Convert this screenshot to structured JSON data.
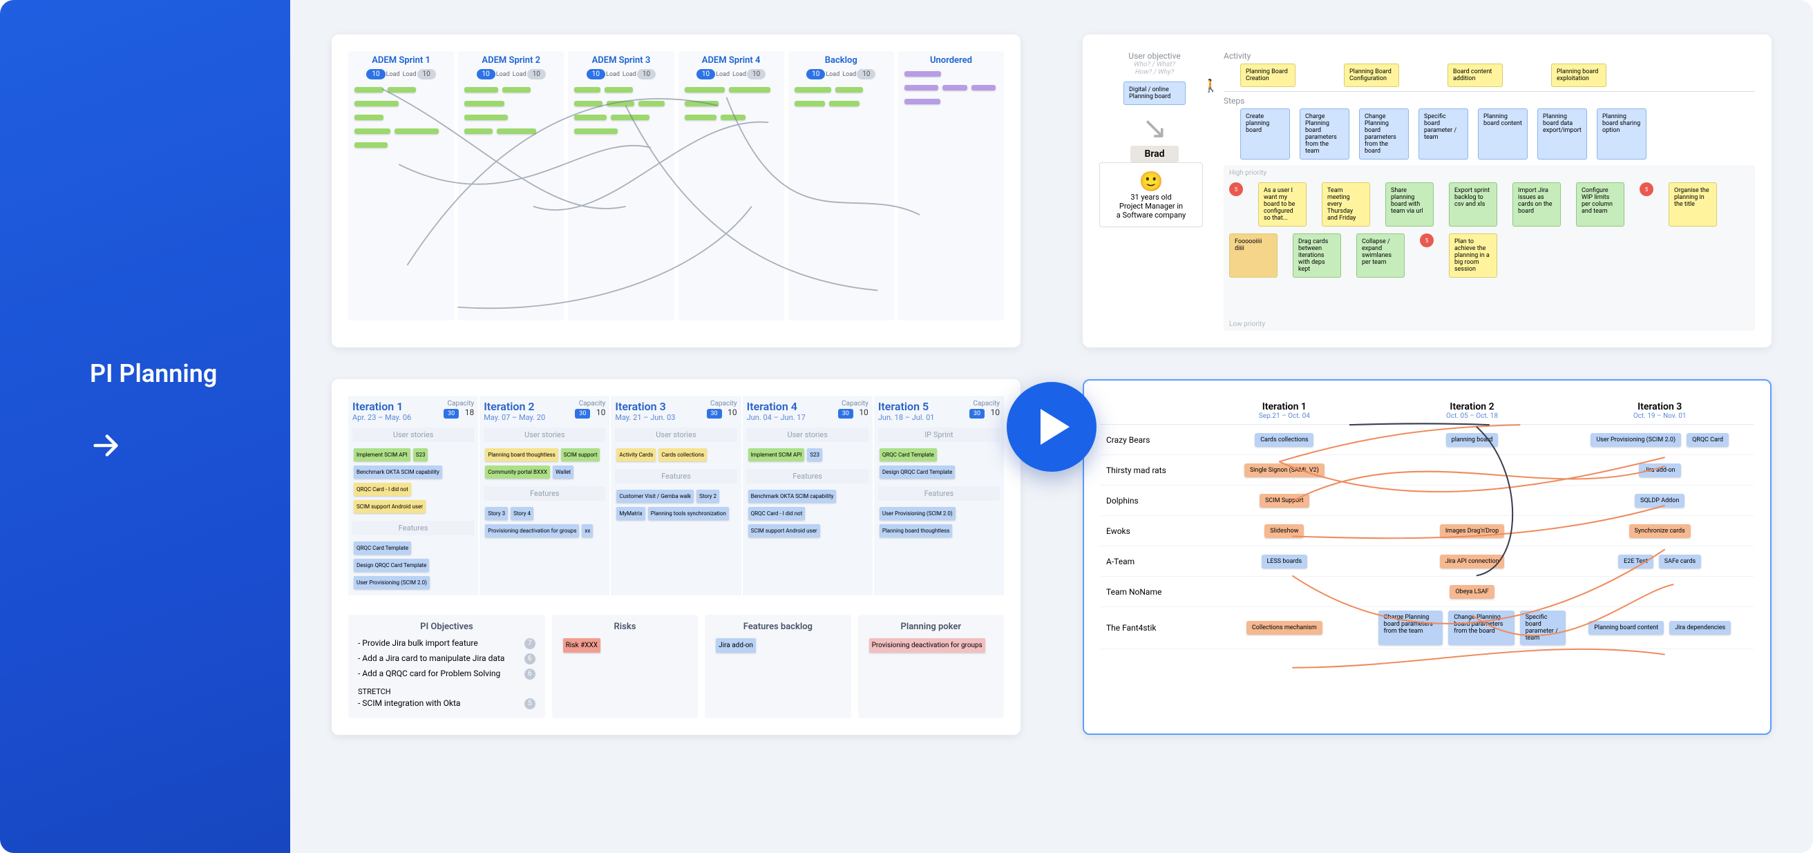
{
  "sidebar": {
    "title": "PI Planning"
  },
  "panel_tl": {
    "columns": [
      {
        "name": "ADEM Sprint 1",
        "load": "Load",
        "load2": "Load",
        "cards": 7
      },
      {
        "name": "ADEM Sprint 2",
        "load": "Load",
        "load2": "Load",
        "cards": 6
      },
      {
        "name": "ADEM Sprint 3",
        "load": "Load",
        "load2": "Load",
        "cards": 8
      },
      {
        "name": "ADEM Sprint 4",
        "load": "Load",
        "load2": "Load",
        "cards": 5
      },
      {
        "name": "Backlog",
        "load": "Load",
        "load2": "Load",
        "cards": 4
      },
      {
        "name": "Unordered",
        "load": "",
        "load2": "",
        "cards": 5
      }
    ]
  },
  "panel_tr": {
    "label_user_objective": "User objective",
    "label_sub1": "Who? / What?",
    "label_sub2": "How? / Why?",
    "label_activity": "Activity",
    "label_steps": "Steps",
    "label_high": "High priority",
    "label_low": "Low priority",
    "persona_name": "Brad",
    "persona_line1": "31 years old",
    "persona_line2": "Project Manager in",
    "persona_line3": "a Software company",
    "root_card": "Digital / online Planning board",
    "activities": [
      "Planning Board Creation",
      "Planning Board Configuration",
      "Board content addition",
      "Planning board exploitation"
    ],
    "steps": [
      "Create planning board",
      "Charge Planning board parameters from the team",
      "Change Planning board parameters from the board",
      "Specific board parameter / team",
      "Planning board content",
      "Planning board data export/import",
      "Planning board sharing option"
    ]
  },
  "panel_bl": {
    "iterations": [
      {
        "title": "Iteration 1",
        "dates": "Apr. 23 – May. 06",
        "cap": "30",
        "count": "18",
        "band": "User stories"
      },
      {
        "title": "Iteration 2",
        "dates": "May. 07 – May. 20",
        "cap": "30",
        "count": "10",
        "band": "User stories"
      },
      {
        "title": "Iteration 3",
        "dates": "May. 21 – Jun. 03",
        "cap": "30",
        "count": "10",
        "band": "User stories"
      },
      {
        "title": "Iteration 4",
        "dates": "Jun. 04 – Jun. 17",
        "cap": "30",
        "count": "10",
        "band": "User stories"
      },
      {
        "title": "Iteration 5",
        "dates": "Jun. 18 – Jul. 01",
        "cap": "30",
        "count": "10",
        "band": "IP Sprint"
      }
    ],
    "capacity_label": "Capacity",
    "features_band": "Features",
    "objectives_title": "PI Objectives",
    "objectives": [
      {
        "text": "- Provide Jira bulk import feature",
        "badge": "7"
      },
      {
        "text": "- Add a Jira card to manipulate Jira data",
        "badge": "6"
      },
      {
        "text": "- Add a QRQC card for Problem Solving",
        "badge": "6"
      }
    ],
    "stretch_label": "STRETCH",
    "stretch_item": "- SCIM integration with Okta",
    "stretch_badge": "5",
    "risks_title": "Risks",
    "risks_card": "Risk #XXX",
    "backlog_title": "Features backlog",
    "backlog_card": "Jira add-on",
    "poker_title": "Planning poker",
    "poker_card": "Provisioning deactivation for groups",
    "story_cards": [
      "Implement SCIM API",
      "S23",
      "Benchmark OKTA SCIM capability",
      "QRQC Card - I did not",
      "SCIM support Android user",
      "QRQC Card Template",
      "Design QRQC Card Template",
      "User Provisioning (SCIM 2.0)",
      "Planning board thoughtless",
      "SCIM support",
      "Community portal BXXX",
      "Wallet",
      "Story 3",
      "Story 4",
      "Provisioning deactivation for groups",
      "xx",
      "Activity Cards",
      "Cards collections",
      "Customer Visit / Gemba walk",
      "Story 2",
      "MyMatrix",
      "Planning tools synchronization"
    ]
  },
  "panel_br": {
    "iterations": [
      {
        "title": "Iteration 1",
        "dates": "Sep.21 – Oct. 04"
      },
      {
        "title": "Iteration 2",
        "dates": "Oct. 05 – Oct. 18"
      },
      {
        "title": "Iteration 3",
        "dates": "Oct. 19 – Nov. 01"
      }
    ],
    "teams": [
      "Crazy Bears",
      "Thirsty mad rats",
      "Dolphins",
      "Ewoks",
      "A-Team",
      "Team NoName",
      "The Fant4stik"
    ],
    "chips": {
      "0-0": [
        {
          "c": "blue",
          "t": "Cards collections"
        }
      ],
      "0-1": [
        {
          "c": "blue",
          "t": "planning board"
        }
      ],
      "0-2": [
        {
          "c": "blue",
          "t": "User Provisioning (SCIM 2.0)"
        },
        {
          "c": "blue",
          "t": "QRQC Card"
        }
      ],
      "1-0": [
        {
          "c": "orange",
          "t": "Single Signon (SAML V2)"
        }
      ],
      "1-2": [
        {
          "c": "blue",
          "t": "Jira add-on"
        }
      ],
      "2-0": [
        {
          "c": "orange",
          "t": "SCIM Support"
        }
      ],
      "2-2": [
        {
          "c": "blue",
          "t": "SQLDP Addon"
        }
      ],
      "3-0": [
        {
          "c": "orange",
          "t": "Slideshow"
        }
      ],
      "3-1": [
        {
          "c": "orange",
          "t": "Images Drag'n'Drop"
        }
      ],
      "3-2": [
        {
          "c": "orange",
          "t": "Synchronize cards"
        }
      ],
      "4-0": [
        {
          "c": "blue",
          "t": "LESS boards"
        }
      ],
      "4-1": [
        {
          "c": "orange",
          "t": "Jira API connection"
        }
      ],
      "4-2": [
        {
          "c": "blue",
          "t": "E2E Test"
        },
        {
          "c": "blue",
          "t": "SAFe cards"
        }
      ],
      "5-1": [
        {
          "c": "orange",
          "t": "Obeya LSAF"
        }
      ],
      "6-0": [
        {
          "c": "orange",
          "t": "Collections mechanism"
        }
      ],
      "6-1": [
        {
          "c": "blue",
          "t": "Charge Planning board parameters from the team"
        },
        {
          "c": "blue",
          "t": "Change Planning board parameters from the board"
        },
        {
          "c": "blue",
          "t": "Specific board parameter / team"
        }
      ],
      "6-2": [
        {
          "c": "blue",
          "t": "Planning board content"
        },
        {
          "c": "blue",
          "t": "Jira dependencies"
        }
      ]
    }
  }
}
